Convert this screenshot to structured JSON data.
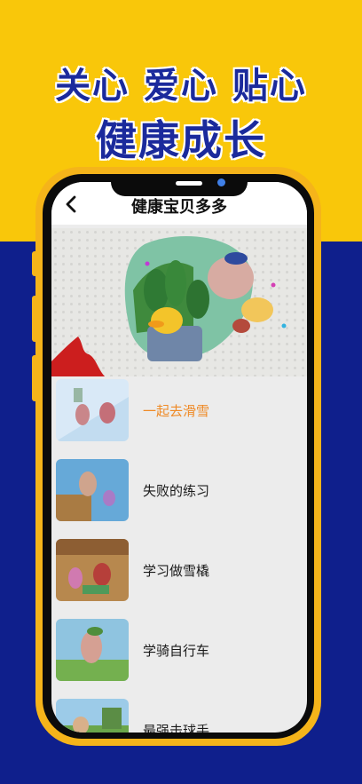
{
  "promo": {
    "slogan_line1": "关心 爱心 贴心",
    "slogan_line2": "健康成长"
  },
  "app": {
    "title": "健康宝贝多多",
    "back_icon": "chevron-left-icon"
  },
  "episodes": [
    {
      "title": "一起去滑雪",
      "active": true
    },
    {
      "title": "失败的练习",
      "active": false
    },
    {
      "title": "学习做雪橇",
      "active": false
    },
    {
      "title": "学骑自行车",
      "active": false
    },
    {
      "title": "最强击球手",
      "active": false
    }
  ],
  "colors": {
    "promo_yellow": "#f9c70a",
    "promo_blue": "#0f1f8c",
    "phone_frame": "#f5b41a",
    "active_episode": "#ef8a26"
  }
}
